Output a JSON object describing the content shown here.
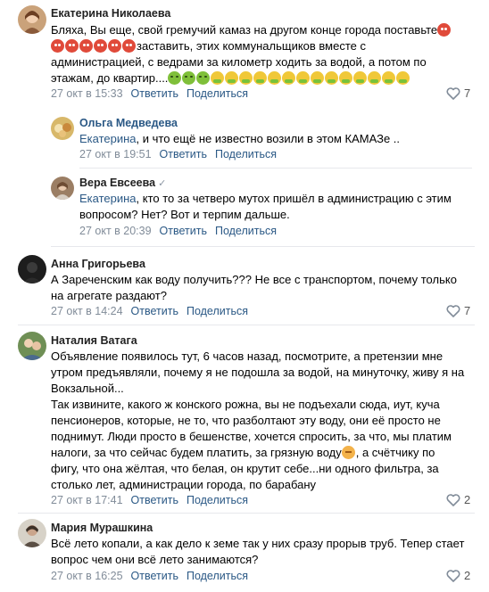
{
  "actions": {
    "reply": "Ответить",
    "share": "Поделиться"
  },
  "colors": {
    "link": "#2a5885",
    "meta": "#818c99",
    "divider": "#e7e8ec"
  },
  "comments": [
    {
      "author": "Екатерина Николаева",
      "text_part1": "Бляха, Вы еще, свой гремучий камаз на другом конце города поставьте",
      "text_part2": "заставить, этих коммунальщиков вместе с администрацией, с ведрами за километр ходить за водой, а потом по этажам, до квартир....",
      "time": "27 окт в 15:33",
      "likes": "7"
    },
    {
      "author": "Ольга Медведева",
      "mention": "Екатерина",
      "text": ", и что ещё не известно возили в этом КАМАЗе ..",
      "time": "27 окт в 19:51"
    },
    {
      "author": "Вера Евсеева",
      "mention": "Екатерина",
      "text": ", кто то за четверо мутох пришёл в администрацию с этим вопросом? Нет? Вот и терпим дальше.",
      "time": "27 окт в 20:39"
    },
    {
      "author": "Анна Григорьева",
      "text": "А Зареченским как воду получить??? Не все с транспортом, почему только на агрегате раздают?",
      "time": "27 окт в 14:24",
      "likes": "7"
    },
    {
      "author": "Наталия Ватага",
      "text_part1": "Объявление появилось тут, 6 часов назад, посмотрите, а претензии мне утром предъявляли, почему я не подошла за водой, на минуточку, живу я на Вокзальной...",
      "text_part2": "Так извините, какого ж конского рожна, вы не подъехали сюда, иут, куча пенсионеров, которые, не то, что разболтают эту воду, они её просто не поднимут. Люди просто в бешенстве, хочется спросить, за что, мы платим налоги, за что сейчас будем платить, за грязную воду",
      "text_part3": ", а счётчику по фигу, что она жёлтая, что белая, он крутит себе...ни одного фильтра, за столько лет, администрации города, по барабану",
      "time": "27 окт в 17:41",
      "likes": "2"
    },
    {
      "author": "Мария Мурашкина",
      "text": "Всё лето копали, а как дело к земе так у них сразу прорыв труб. Тепер стает вопрос чем они всё лето занимаются?",
      "time": "27 окт в 16:25",
      "likes": "2"
    }
  ]
}
